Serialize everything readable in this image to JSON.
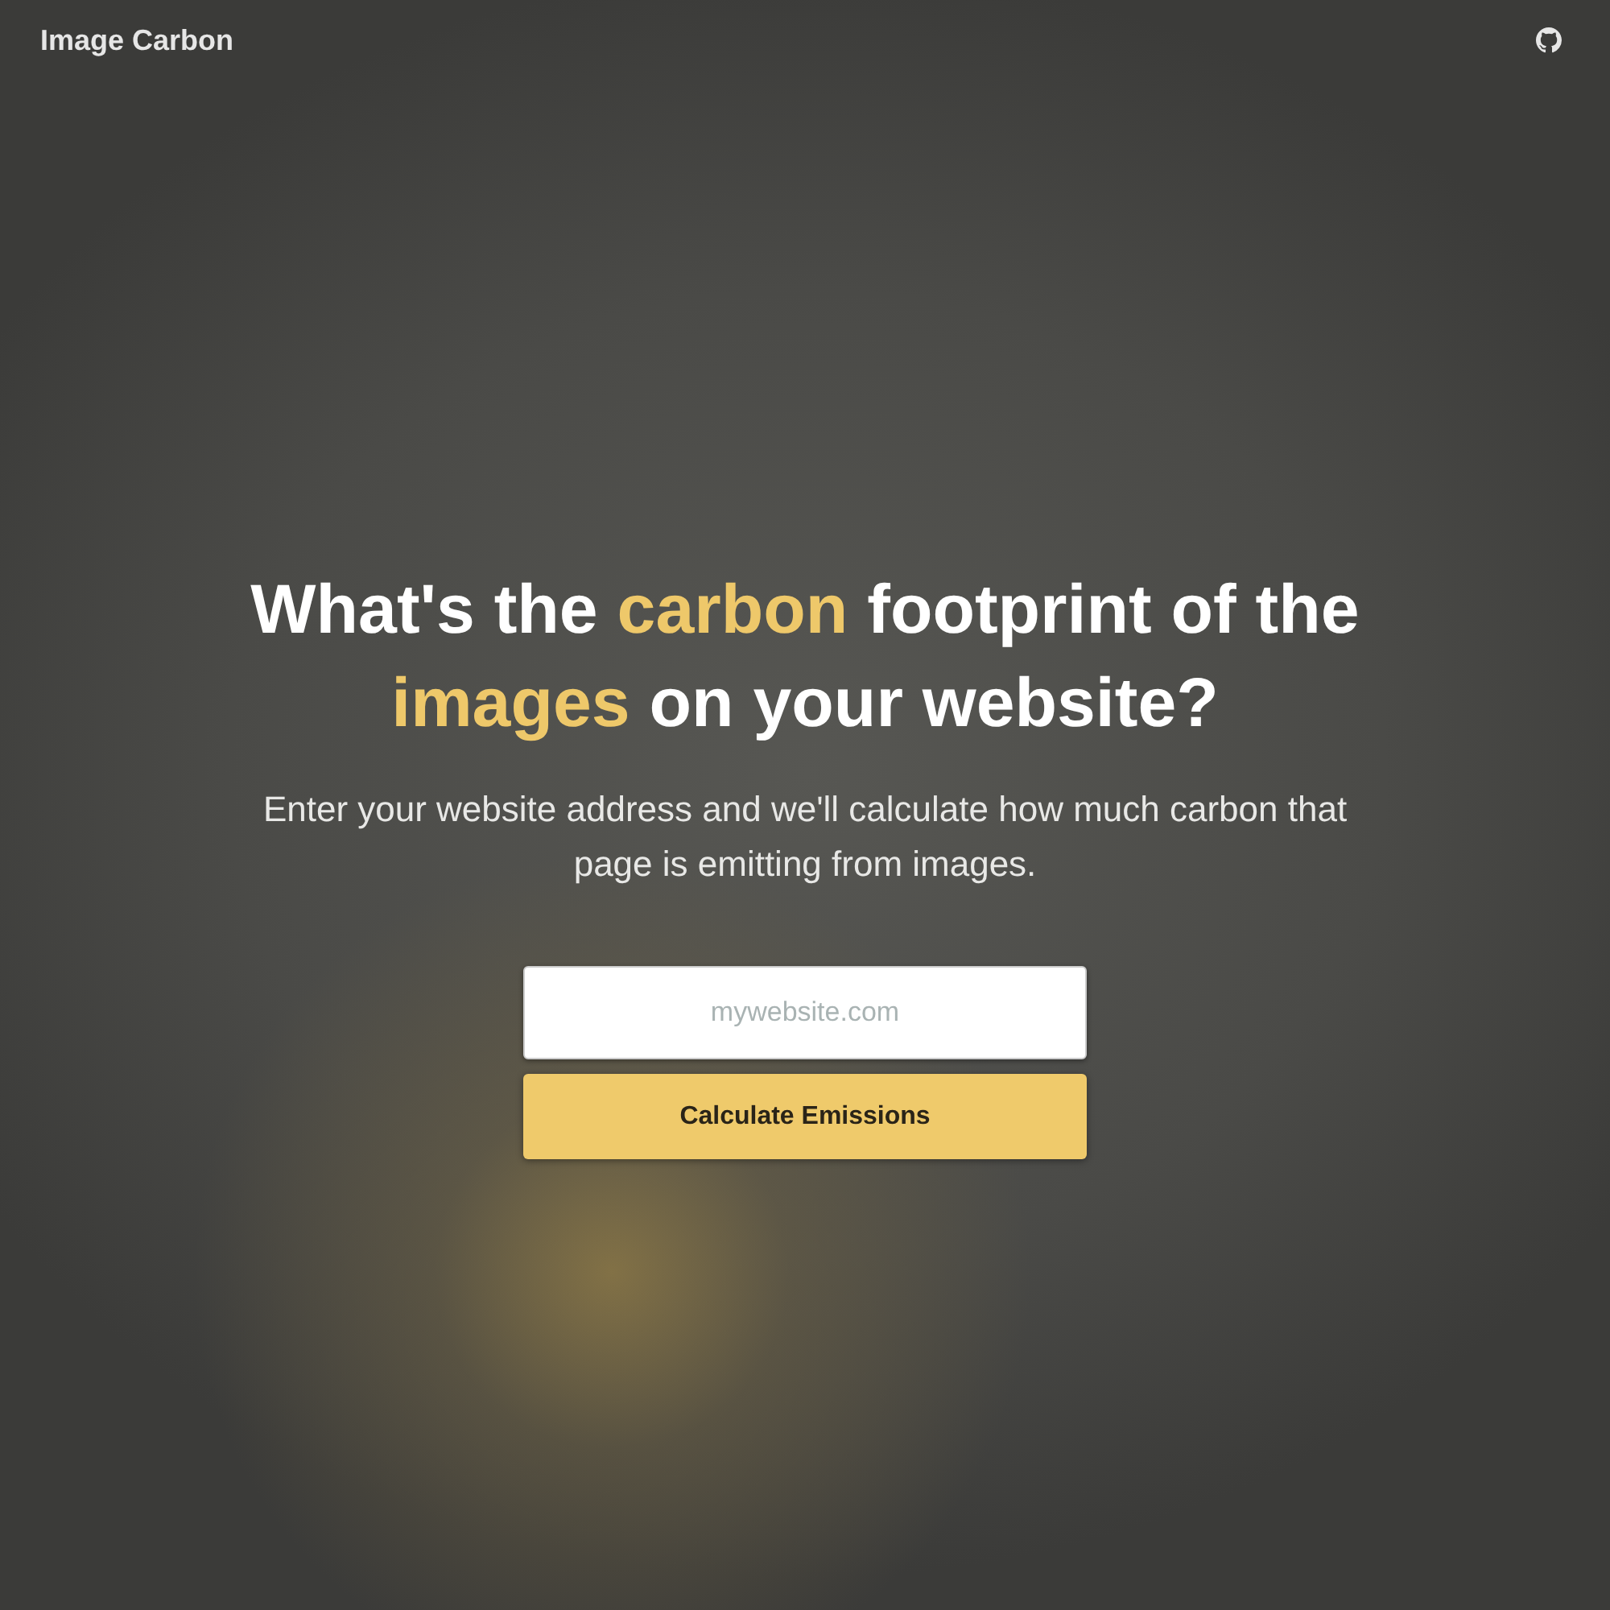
{
  "header": {
    "title": "Image Carbon"
  },
  "hero": {
    "heading": [
      {
        "text": "What's the ",
        "highlight": false
      },
      {
        "text": "carbon",
        "highlight": true
      },
      {
        "text": " footprint of the ",
        "highlight": false
      },
      {
        "text": "images",
        "highlight": true
      },
      {
        "text": " on your website?",
        "highlight": false
      }
    ],
    "description": "Enter your website address and we'll calculate how much carbon that page is emitting from images.",
    "url_field": {
      "placeholder": "mywebsite.com"
    },
    "submit_button": "Calculate Emissions"
  }
}
